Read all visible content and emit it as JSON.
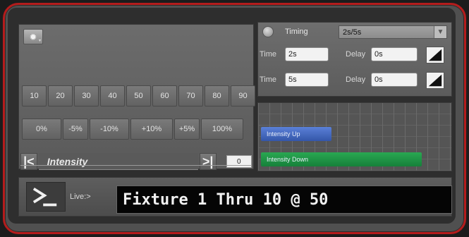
{
  "left_panel": {
    "sun_button_icon": "sun-icon",
    "number_buttons": [
      "10",
      "20",
      "30",
      "40",
      "50",
      "60",
      "70",
      "80",
      "90"
    ],
    "percent_buttons": [
      "0%",
      "-5%",
      "-10%",
      "+10%",
      "+5%",
      "100%"
    ],
    "prev_label": "K",
    "next_label": "█",
    "intensity_label": "Intensity",
    "intensity_value": "0"
  },
  "timing": {
    "label": "Timing",
    "preset_value": "2s/5s",
    "rows": [
      {
        "time_label": "Time",
        "time_value": "2s",
        "delay_label": "Delay",
        "delay_value": "0s"
      },
      {
        "time_label": "Time",
        "time_value": "5s",
        "delay_label": "Delay",
        "delay_value": "0s"
      }
    ]
  },
  "timeline": {
    "cues": [
      {
        "label": "Intensity Up",
        "color": "#3f62c0"
      },
      {
        "label": "Intensity Down",
        "color": "#1f8f44"
      }
    ]
  },
  "command_line": {
    "mode_label": "Live:>",
    "command": "Fixture 1 Thru 10 @ 50"
  },
  "colors": {
    "frame_border": "#b41c1c",
    "panel_bg": "#606060"
  }
}
